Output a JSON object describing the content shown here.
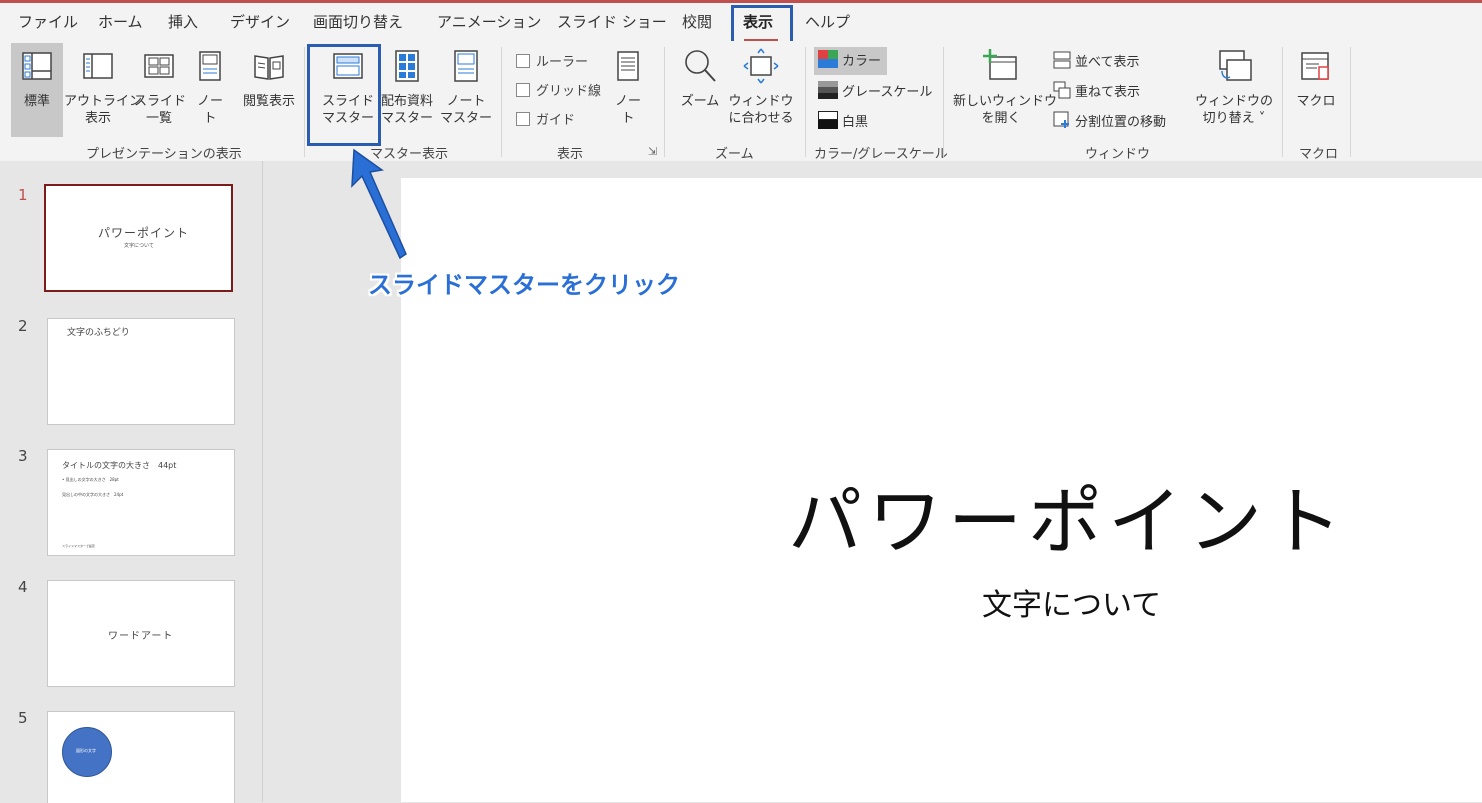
{
  "tabs": [
    "ファイル",
    "ホーム",
    "挿入",
    "デザイン",
    "画面切り替え",
    "アニメーション",
    "スライド ショー",
    "校閲",
    "表示",
    "ヘルプ"
  ],
  "active_tab": "表示",
  "ribbon": {
    "presentation_views": {
      "label": "プレゼンテーションの表示",
      "normal": "標準",
      "outline_1": "アウトライン",
      "outline_2": "表示",
      "sorter_1": "スライド",
      "sorter_2": "一覧",
      "notes_1": "ノー",
      "notes_2": "ト",
      "reading": "閲覧表示"
    },
    "master_views": {
      "label": "マスター表示",
      "slide_master_1": "スライド",
      "slide_master_2": "マスター",
      "handout_master_1": "配布資料",
      "handout_master_2": "マスター",
      "notes_master_1": "ノート",
      "notes_master_2": "マスター"
    },
    "show": {
      "label": "表示",
      "ruler": "ルーラー",
      "gridlines": "グリッド線",
      "guides": "ガイド",
      "notes_1": "ノー",
      "notes_2": "ト"
    },
    "zoom": {
      "label": "ズーム",
      "zoom": "ズーム",
      "fit_1": "ウィンドウ",
      "fit_2": "に合わせる"
    },
    "color": {
      "label": "カラー/グレースケール",
      "color": "カラー",
      "grayscale": "グレースケール",
      "bw": "白黒"
    },
    "window": {
      "label": "ウィンドウ",
      "new_window_1": "新しいウィンドウ",
      "new_window_2": "を開く",
      "arrange_all": "並べて表示",
      "cascade": "重ねて表示",
      "move_split": "分割位置の移動",
      "switch_1": "ウィンドウの",
      "switch_2": "切り替え ˅"
    },
    "macros": {
      "label": "マクロ",
      "macros": "マクロ"
    }
  },
  "slides": [
    {
      "num": "1",
      "title": "パワーポイント",
      "subtitle": "文字について"
    },
    {
      "num": "2",
      "title": "文字のふちどり"
    },
    {
      "num": "3",
      "title": "タイトルの文字の大きさ　44pt",
      "line1": "• 見出しの文字の大きさ　28pt",
      "line2": "見出しの中の文字の大きさ　24pt",
      "footer": "スライドマスターで設定"
    },
    {
      "num": "4",
      "title": "ワードアート"
    },
    {
      "num": "5",
      "shape_text": "図形の文字"
    }
  ],
  "main_slide": {
    "title": "パワーポイント",
    "subtitle": "文字について"
  },
  "annotation": {
    "callout": "スライドマスターをクリック",
    "color": "#2a6fd6"
  },
  "colors": {
    "accent": "#c0504d",
    "highlight": "#2a5db0",
    "shape": "#4472c4"
  }
}
